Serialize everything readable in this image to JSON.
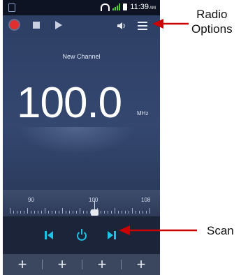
{
  "status_bar": {
    "time": "11:39",
    "ampm": "AM"
  },
  "radio": {
    "channel_name": "New Channel",
    "frequency": "100.0",
    "unit": "MHz",
    "dial_labels": [
      "90",
      "100",
      "108"
    ],
    "tuned_frequency": 100.0,
    "dial_range": [
      87.5,
      108
    ]
  },
  "annotations": {
    "radio_options_line1": "Radio",
    "radio_options_line2": "Options",
    "scan": "Scan"
  },
  "colors": {
    "accent": "#1ec1e8",
    "record": "#e12f2f",
    "arrow": "#cc0000"
  },
  "icons": [
    "record-icon",
    "stop-icon",
    "play-icon",
    "volume-icon",
    "menu-icon",
    "prev-station-icon",
    "power-icon",
    "next-station-icon",
    "add-icon"
  ],
  "favorites": [
    "+",
    "+",
    "+",
    "+"
  ]
}
